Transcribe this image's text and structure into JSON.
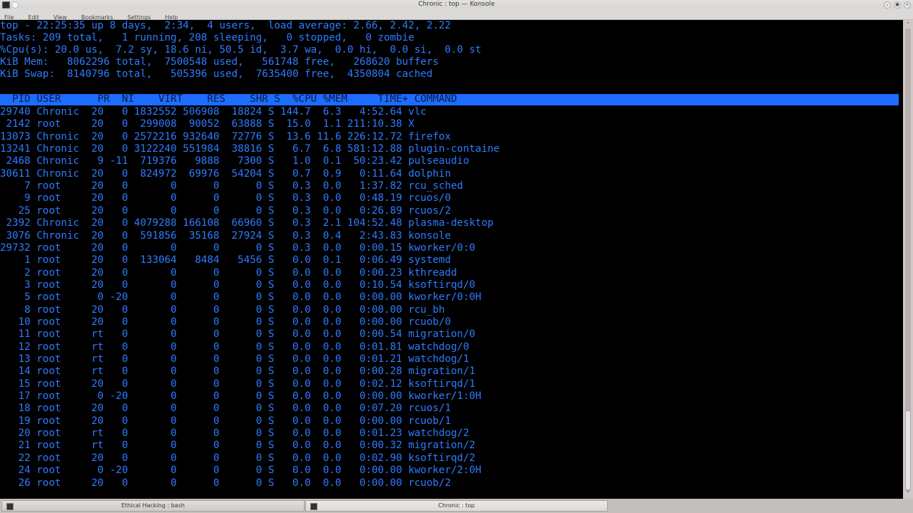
{
  "window": {
    "title": "Chronic : top — Konsole",
    "buttons": [
      "minimize",
      "maximize",
      "close"
    ]
  },
  "menu": [
    "File",
    "Edit",
    "View",
    "Bookmarks",
    "Settings",
    "Help"
  ],
  "summary": {
    "line1": "top - 22:25:35 up 8 days,  2:34,  4 users,  load average: 2.66, 2.42, 2.22",
    "line2": "Tasks: 209 total,   1 running, 208 sleeping,   0 stopped,   0 zombie",
    "line3": "%Cpu(s): 20.0 us,  7.2 sy, 18.6 ni, 50.5 id,  3.7 wa,  0.0 hi,  0.0 si,  0.0 st",
    "line4": "KiB Mem:   8062296 total,  7500548 used,   561748 free,   268620 buffers",
    "line5": "KiB Swap:  8140796 total,   505396 used,  7635400 free,  4350804 cached"
  },
  "table": {
    "header": "  PID USER      PR  NI    VIRT    RES    SHR S  %CPU %MEM     TIME+ COMMAND",
    "columns": [
      "PID",
      "USER",
      "PR",
      "NI",
      "VIRT",
      "RES",
      "SHR",
      "S",
      "%CPU",
      "%MEM",
      "TIME+",
      "COMMAND"
    ],
    "rows": [
      [
        "29740",
        "Chronic",
        "20",
        "0",
        "1832552",
        "506908",
        "18824",
        "S",
        "144.7",
        "6.3",
        "4:52.64",
        "vlc"
      ],
      [
        "2142",
        "root",
        "20",
        "0",
        "299008",
        "90052",
        "63888",
        "S",
        "15.0",
        "1.1",
        "211:10.38",
        "X"
      ],
      [
        "13073",
        "Chronic",
        "20",
        "0",
        "2572216",
        "932640",
        "72776",
        "S",
        "13.6",
        "11.6",
        "226:12.72",
        "firefox"
      ],
      [
        "13241",
        "Chronic",
        "20",
        "0",
        "3122240",
        "551984",
        "38816",
        "S",
        "6.7",
        "6.8",
        "581:12.88",
        "plugin-containe"
      ],
      [
        "2468",
        "Chronic",
        "9",
        "-11",
        "719376",
        "9888",
        "7300",
        "S",
        "1.0",
        "0.1",
        "50:23.42",
        "pulseaudio"
      ],
      [
        "30611",
        "Chronic",
        "20",
        "0",
        "824972",
        "69976",
        "54204",
        "S",
        "0.7",
        "0.9",
        "0:11.64",
        "dolphin"
      ],
      [
        "7",
        "root",
        "20",
        "0",
        "0",
        "0",
        "0",
        "S",
        "0.3",
        "0.0",
        "1:37.82",
        "rcu_sched"
      ],
      [
        "9",
        "root",
        "20",
        "0",
        "0",
        "0",
        "0",
        "S",
        "0.3",
        "0.0",
        "0:48.19",
        "rcuos/0"
      ],
      [
        "25",
        "root",
        "20",
        "0",
        "0",
        "0",
        "0",
        "S",
        "0.3",
        "0.0",
        "0:26.89",
        "rcuos/2"
      ],
      [
        "2392",
        "Chronic",
        "20",
        "0",
        "4079288",
        "166108",
        "66960",
        "S",
        "0.3",
        "2.1",
        "104:52.48",
        "plasma-desktop"
      ],
      [
        "3076",
        "Chronic",
        "20",
        "0",
        "591856",
        "35168",
        "27924",
        "S",
        "0.3",
        "0.4",
        "2:43.83",
        "konsole"
      ],
      [
        "29732",
        "root",
        "20",
        "0",
        "0",
        "0",
        "0",
        "S",
        "0.3",
        "0.0",
        "0:00.15",
        "kworker/0:0"
      ],
      [
        "1",
        "root",
        "20",
        "0",
        "133064",
        "8484",
        "5456",
        "S",
        "0.0",
        "0.1",
        "0:06.49",
        "systemd"
      ],
      [
        "2",
        "root",
        "20",
        "0",
        "0",
        "0",
        "0",
        "S",
        "0.0",
        "0.0",
        "0:00.23",
        "kthreadd"
      ],
      [
        "3",
        "root",
        "20",
        "0",
        "0",
        "0",
        "0",
        "S",
        "0.0",
        "0.0",
        "0:10.54",
        "ksoftirqd/0"
      ],
      [
        "5",
        "root",
        "0",
        "-20",
        "0",
        "0",
        "0",
        "S",
        "0.0",
        "0.0",
        "0:00.00",
        "kworker/0:0H"
      ],
      [
        "8",
        "root",
        "20",
        "0",
        "0",
        "0",
        "0",
        "S",
        "0.0",
        "0.0",
        "0:00.00",
        "rcu_bh"
      ],
      [
        "10",
        "root",
        "20",
        "0",
        "0",
        "0",
        "0",
        "S",
        "0.0",
        "0.0",
        "0:00.00",
        "rcuob/0"
      ],
      [
        "11",
        "root",
        "rt",
        "0",
        "0",
        "0",
        "0",
        "S",
        "0.0",
        "0.0",
        "0:00.54",
        "migration/0"
      ],
      [
        "12",
        "root",
        "rt",
        "0",
        "0",
        "0",
        "0",
        "S",
        "0.0",
        "0.0",
        "0:01.81",
        "watchdog/0"
      ],
      [
        "13",
        "root",
        "rt",
        "0",
        "0",
        "0",
        "0",
        "S",
        "0.0",
        "0.0",
        "0:01.21",
        "watchdog/1"
      ],
      [
        "14",
        "root",
        "rt",
        "0",
        "0",
        "0",
        "0",
        "S",
        "0.0",
        "0.0",
        "0:00.28",
        "migration/1"
      ],
      [
        "15",
        "root",
        "20",
        "0",
        "0",
        "0",
        "0",
        "S",
        "0.0",
        "0.0",
        "0:02.12",
        "ksoftirqd/1"
      ],
      [
        "17",
        "root",
        "0",
        "-20",
        "0",
        "0",
        "0",
        "S",
        "0.0",
        "0.0",
        "0:00.00",
        "kworker/1:0H"
      ],
      [
        "18",
        "root",
        "20",
        "0",
        "0",
        "0",
        "0",
        "S",
        "0.0",
        "0.0",
        "0:07.20",
        "rcuos/1"
      ],
      [
        "19",
        "root",
        "20",
        "0",
        "0",
        "0",
        "0",
        "S",
        "0.0",
        "0.0",
        "0:00.00",
        "rcuob/1"
      ],
      [
        "20",
        "root",
        "rt",
        "0",
        "0",
        "0",
        "0",
        "S",
        "0.0",
        "0.0",
        "0:01.23",
        "watchdog/2"
      ],
      [
        "21",
        "root",
        "rt",
        "0",
        "0",
        "0",
        "0",
        "S",
        "0.0",
        "0.0",
        "0:00.32",
        "migration/2"
      ],
      [
        "22",
        "root",
        "20",
        "0",
        "0",
        "0",
        "0",
        "S",
        "0.0",
        "0.0",
        "0:02.90",
        "ksoftirqd/2"
      ],
      [
        "24",
        "root",
        "0",
        "-20",
        "0",
        "0",
        "0",
        "S",
        "0.0",
        "0.0",
        "0:00.00",
        "kworker/2:0H"
      ],
      [
        "26",
        "root",
        "20",
        "0",
        "0",
        "0",
        "0",
        "S",
        "0.0",
        "0.0",
        "0:00.00",
        "rcuob/2"
      ]
    ]
  },
  "taskbar": {
    "tabs": [
      {
        "label": "Ethical Hacking : bash",
        "active": false
      },
      {
        "label": "Chronic : top",
        "active": true
      }
    ]
  },
  "colors": {
    "terminal_bg": "#000000",
    "text_label": "#3aa0ff",
    "text_number": "#3a4fe0",
    "header_bar": "#1c6cff",
    "header_text": "#0a1a40"
  }
}
